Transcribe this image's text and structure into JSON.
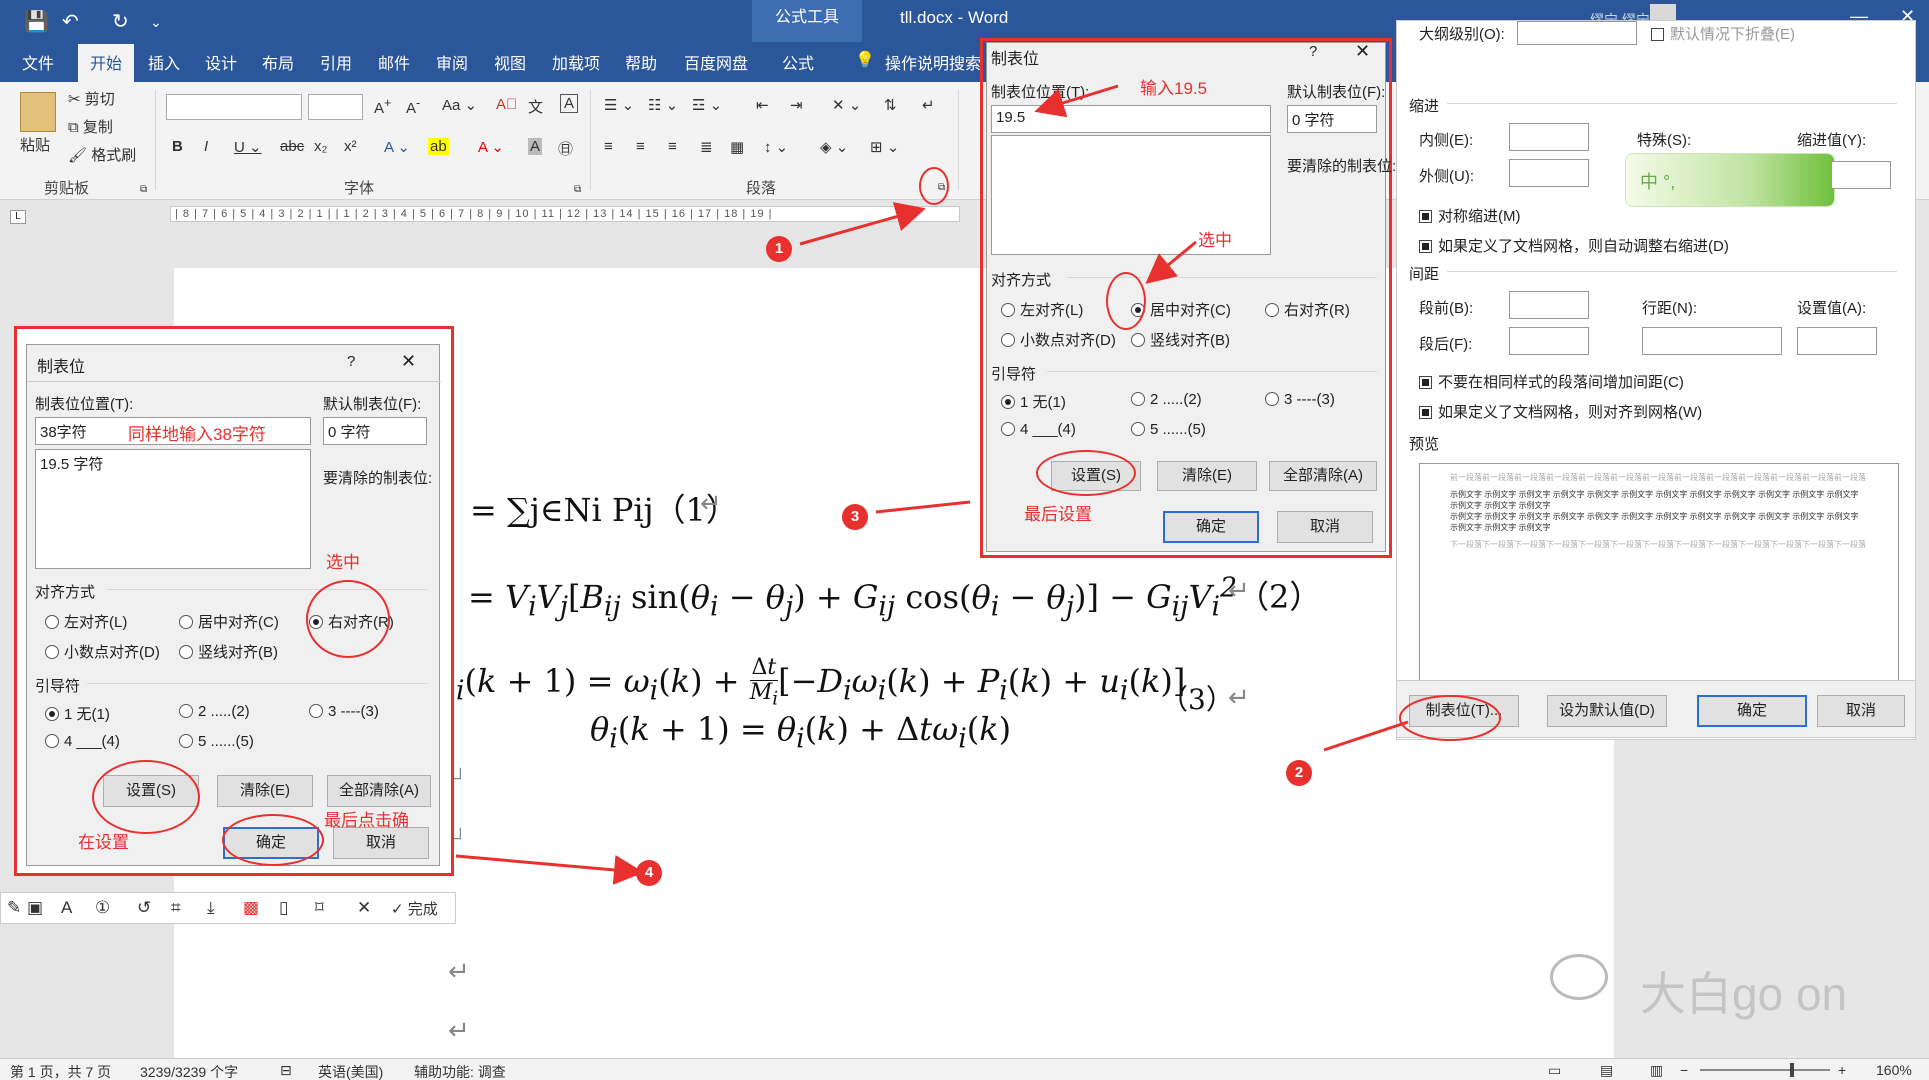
{
  "window": {
    "title": "tll.docx  -  Word",
    "context_tab": "公式工具",
    "user": "缪宁 缪宁"
  },
  "tabs": [
    "文件",
    "开始",
    "插入",
    "设计",
    "布局",
    "引用",
    "邮件",
    "审阅",
    "视图",
    "加载项",
    "帮助",
    "百度网盘",
    "公式"
  ],
  "tell_me": "操作说明搜索",
  "ribbon": {
    "clipboard": {
      "name": "剪贴板",
      "paste": "粘贴",
      "cut": "剪切",
      "copy": "复制",
      "format_painter": "格式刷"
    },
    "font": {
      "name": "字体"
    },
    "paragraph": {
      "name": "段落"
    }
  },
  "ruler_text": "| 8 | 7 | 6 | 5 | 4 | 3 | 2 | 1 |   | 1 | 2 | 3 | 4 | 5 | 6 | 7 | 8 | 9 | 10 | 11 | 12 | 13 | 14 | 15 | 16 | 17 | 18 | 19 |",
  "equations": {
    "eq1": "= ∑j∈Ni Pij（1）",
    "eq2_num": "（2）",
    "eq3_num": "（3）"
  },
  "dialog_right": {
    "title": "制表位",
    "help": "?",
    "tab_pos_label": "制表位位置(T):",
    "tab_pos_value": "19.5",
    "default_label": "默认制表位(F):",
    "default_value": "0 字符",
    "clear_label": "要清除的制表位:",
    "align_label": "对齐方式",
    "align_left": "左对齐(L)",
    "align_center": "居中对齐(C)",
    "align_right": "右对齐(R)",
    "align_decimal": "小数点对齐(D)",
    "align_bar": "竖线对齐(B)",
    "leader_label": "引导符",
    "leader1": "1 无(1)",
    "leader2": "2 .....(2)",
    "leader3": "3 ----(3)",
    "leader4": "4 ___(4)",
    "leader5": "5 ......(5)",
    "set": "设置(S)",
    "clear": "清除(E)",
    "clear_all": "全部清除(A)",
    "ok": "确定",
    "cancel": "取消"
  },
  "dialog_left": {
    "title": "制表位",
    "help": "?",
    "tab_pos_label": "制表位位置(T):",
    "tab_pos_value": "38字符",
    "list_item": "19.5 字符",
    "default_label": "默认制表位(F):",
    "default_value": "0 字符",
    "clear_label": "要清除的制表位:",
    "align_label": "对齐方式",
    "align_left": "左对齐(L)",
    "align_center": "居中对齐(C)",
    "align_right": "右对齐(R)",
    "align_decimal": "小数点对齐(D)",
    "align_bar": "竖线对齐(B)",
    "leader_label": "引导符",
    "leader1": "1 无(1)",
    "leader2": "2 .....(2)",
    "leader3": "3 ----(3)",
    "leader4": "4 ___(4)",
    "leader5": "5 ......(5)",
    "set": "设置(S)",
    "clear": "清除(E)",
    "clear_all": "全部清除(A)",
    "ok": "确定",
    "cancel": "取消"
  },
  "para_dialog": {
    "outline_label": "大纲级别(O):",
    "collapse": "默认情况下折叠(E)",
    "indent_label": "缩进",
    "inner": "内侧(E):",
    "outer": "外侧(U):",
    "special": "特殊(S):",
    "indent_value": "缩进值(Y):",
    "mirror": "对称缩进(M)",
    "auto_right": "如果定义了文档网格，则自动调整右缩进(D)",
    "spacing_label": "间距",
    "before": "段前(B):",
    "after": "段后(F):",
    "line_spacing": "行距(N):",
    "set_value": "设置值(A):",
    "no_space": "不要在相同样式的段落间增加间距(C)",
    "snap_grid": "如果定义了文档网格，则对齐到网格(W)",
    "preview": "预览",
    "preview_prev": "前一段落前一段落前一段落前一段落前一段落前一段落前一段落前一段落前一段落前一段落前一段落前一段落前一段落",
    "preview_sample": "示例文字 示例文字 示例文字 示例文字 示例文字 示例文字 示例文字 示例文字 示例文字 示例文字 示例文字 示例文字 示例文字 示例文字 示例文字",
    "preview_next": "下一段落下一段落下一段落下一段落下一段落下一段落下一段落下一段落下一段落下一段落下一段落下一段落下一段落",
    "tabs_btn": "制表位(T)...",
    "set_default": "设为默认值(D)",
    "ok": "确定",
    "cancel": "取消",
    "ime_text": "中 °,"
  },
  "annotations": {
    "input_195": "输入19.5",
    "select1": "选中",
    "last_set": "最后设置",
    "same_38": "同样地输入38字符",
    "select2": "选中",
    "then_set": "在设置",
    "last_ok": "最后点击确",
    "n1": "1",
    "n2": "2",
    "n3": "3",
    "n4": "4"
  },
  "snip_toolbar": {
    "done": "完成"
  },
  "watermark": "大白go on",
  "status": {
    "page": "第 1 页，共 7 页",
    "words": "3239/3239 个字",
    "lang": "英语(美国)",
    "access": "辅助功能: 调查",
    "zoom": "160%"
  }
}
